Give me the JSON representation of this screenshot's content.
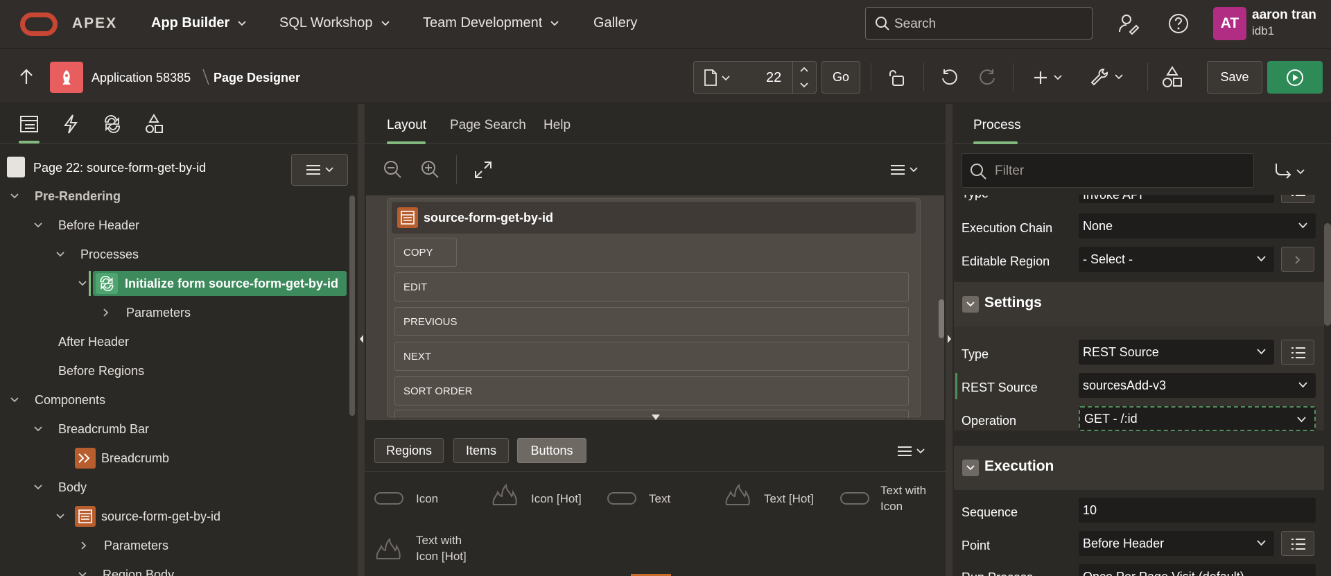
{
  "topnav": {
    "brand": "APEX",
    "items": [
      {
        "label": "App Builder"
      },
      {
        "label": "SQL Workshop"
      },
      {
        "label": "Team Development"
      },
      {
        "label": "Gallery"
      }
    ],
    "search_placeholder": "Search",
    "user": {
      "initials": "AT",
      "name": "aaron tran",
      "workspace": "idb1"
    }
  },
  "toolbar": {
    "application": "Application 58385",
    "page_designer": "Page Designer",
    "page_number": "22",
    "go_label": "Go",
    "save_label": "Save"
  },
  "left": {
    "page_title": "Page 22: source-form-get-by-id",
    "tree": [
      {
        "label": "Pre-Rendering"
      },
      {
        "label": "Before Header"
      },
      {
        "label": "Processes"
      },
      {
        "label": "Initialize form source-form-get-by-id"
      },
      {
        "label": "Parameters"
      },
      {
        "label": "After Header"
      },
      {
        "label": "Before Regions"
      },
      {
        "label": "Components"
      },
      {
        "label": "Breadcrumb Bar"
      },
      {
        "label": "Breadcrumb"
      },
      {
        "label": "Body"
      },
      {
        "label": "source-form-get-by-id"
      },
      {
        "label": "Parameters"
      },
      {
        "label": "Region Body"
      }
    ]
  },
  "center": {
    "tabs": [
      "Layout",
      "Page Search",
      "Help"
    ],
    "region_title": "source-form-get-by-id",
    "button_slots": [
      "COPY",
      "EDIT",
      "PREVIOUS",
      "NEXT",
      "SORT ORDER"
    ],
    "gallery_tabs": [
      "Regions",
      "Items",
      "Buttons"
    ],
    "gallery_items": [
      {
        "label": "Icon"
      },
      {
        "label": "Icon [Hot]"
      },
      {
        "label": "Text"
      },
      {
        "label": "Text [Hot]"
      },
      {
        "label": "Text with Icon"
      },
      {
        "label": "Text with Icon [Hot]"
      }
    ]
  },
  "right": {
    "title": "Process",
    "filter_placeholder": "Filter",
    "props_top": [
      {
        "label": "Type",
        "value": "Invoke API"
      },
      {
        "label": "Execution Chain",
        "value": "None"
      },
      {
        "label": "Editable Region",
        "value": "- Select -"
      }
    ],
    "settings": {
      "title": "Settings",
      "props": [
        {
          "label": "Type",
          "value": "REST Source"
        },
        {
          "label": "REST Source",
          "value": "sourcesAdd-v3"
        },
        {
          "label": "Operation",
          "value": "GET - /:id"
        }
      ]
    },
    "execution": {
      "title": "Execution",
      "props": [
        {
          "label": "Sequence",
          "value": "10"
        },
        {
          "label": "Point",
          "value": "Before Header"
        },
        {
          "label": "Run Process",
          "value": "Once Per Page Visit (default)"
        }
      ]
    }
  },
  "colors": {
    "accent_green": "#82b97f",
    "selected_node": "#3d8a5c",
    "save_run": "#2e8b57",
    "oracle_red": "#c74634",
    "avatar": "#b12d84"
  }
}
